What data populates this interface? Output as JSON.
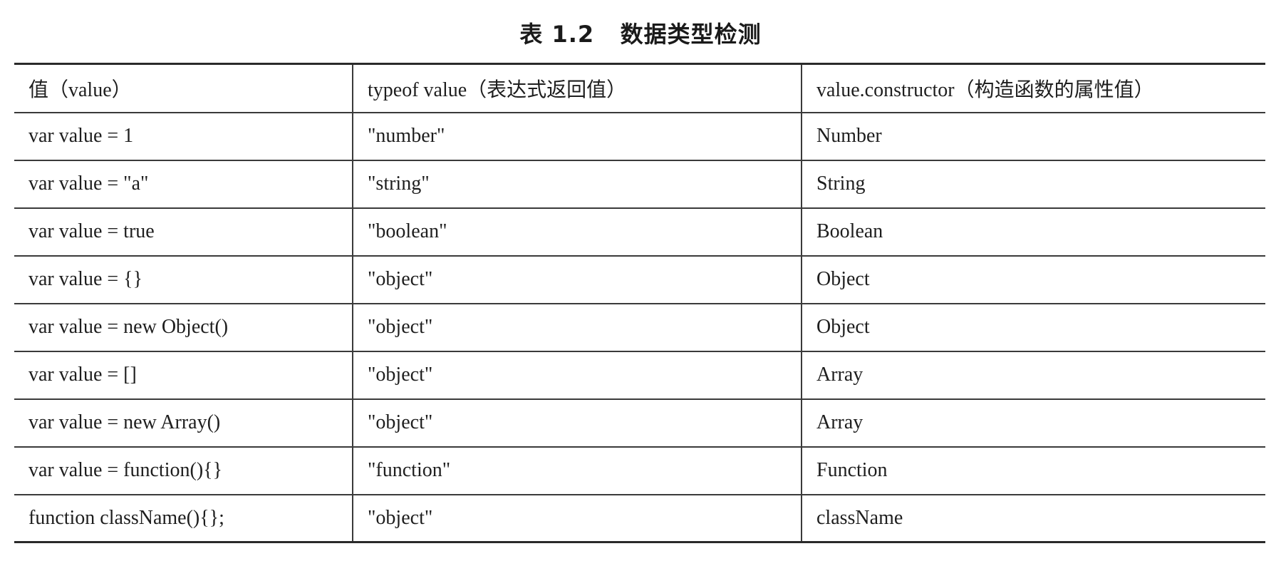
{
  "caption": "表 1.2   数据类型检测",
  "headers": [
    "值（value）",
    "typeof value（表达式返回值）",
    "value.constructor（构造函数的属性值）"
  ],
  "rows": [
    [
      "var value = 1",
      "\"number\"",
      "Number"
    ],
    [
      "var value = \"a\"",
      "\"string\"",
      "String"
    ],
    [
      "var value = true",
      "\"boolean\"",
      "Boolean"
    ],
    [
      "var value = {}",
      "\"object\"",
      "Object"
    ],
    [
      "var value = new Object()",
      "\"object\"",
      "Object"
    ],
    [
      "var value = []",
      "\"object\"",
      "Array"
    ],
    [
      "var value = new Array()",
      "\"object\"",
      "Array"
    ],
    [
      "var value = function(){}",
      "\"function\"",
      "Function"
    ],
    [
      "function className(){};",
      "\"object\"",
      "className"
    ]
  ]
}
